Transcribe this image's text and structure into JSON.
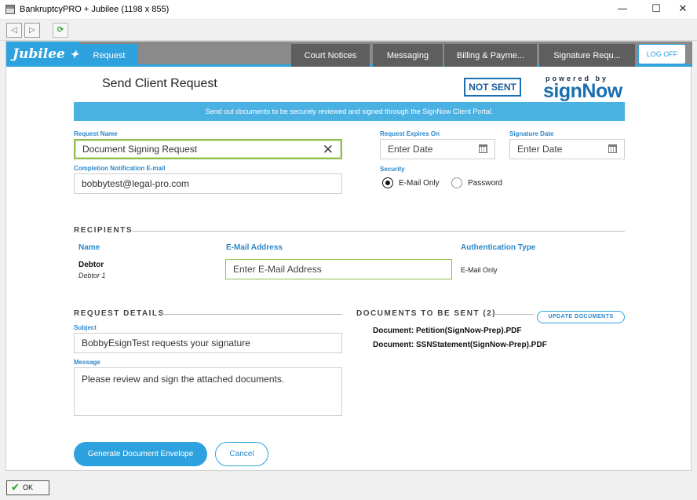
{
  "window": {
    "title": "BankruptcyPRO + Jubilee (1198 x 855)",
    "minimize_glyph": "—",
    "maximize_glyph": "☐",
    "close_glyph": "✕"
  },
  "toolbar": {
    "back_icon": "◁",
    "forward_icon": "▷",
    "refresh_icon": "⟳"
  },
  "nav": {
    "brand": "Jubilee",
    "tabs": [
      {
        "label": "Request"
      },
      {
        "label": "Court Notices"
      },
      {
        "label": "Messaging"
      },
      {
        "label": "Billing & Payme..."
      },
      {
        "label": "Signature Requ..."
      }
    ],
    "logoff": "LOG OFF"
  },
  "header": {
    "title": "Send Client Request",
    "status": "NOT SENT",
    "powered_by": "powered by",
    "partner": "signNow"
  },
  "banner": "Send out documents to be securely reviewed and signed through the SignNow Client Portal.",
  "form": {
    "request_name_label": "Request Name",
    "request_name_value": "Document Signing Request",
    "completion_email_label": "Completion Notification E-mail",
    "completion_email_value": "bobbytest@legal-pro.com",
    "expires_label": "Request Expires On",
    "expires_placeholder": "Enter Date",
    "signature_date_label": "Signature Date",
    "signature_date_placeholder": "Enter Date",
    "security_label": "Security",
    "security_options": [
      "E-Mail Only",
      "Password"
    ],
    "security_selected": "E-Mail Only"
  },
  "recipients": {
    "section_title": "RECIPIENTS",
    "columns": [
      "Name",
      "E-Mail Address",
      "Authentication Type"
    ],
    "rows": [
      {
        "name": "Debtor",
        "role": "Debtor 1",
        "email_placeholder": "Enter E-Mail Address",
        "auth": "E-Mail Only"
      }
    ]
  },
  "details": {
    "section_title": "REQUEST DETAILS",
    "subject_label": "Subject",
    "subject_value": "BobbyEsignTest requests your signature",
    "message_label": "Message",
    "message_value": "Please review and sign the attached documents."
  },
  "documents": {
    "section_title": "DOCUMENTS TO BE SENT (2)",
    "update_label": "UPDATE DOCUMENTS",
    "items": [
      "Document: Petition(SignNow-Prep).PDF",
      "Document: SSNStatement(SignNow-Prep).PDF"
    ]
  },
  "actions": {
    "generate": "Generate Document Envelope",
    "cancel": "Cancel"
  },
  "status_bar": {
    "ok": "OK"
  }
}
